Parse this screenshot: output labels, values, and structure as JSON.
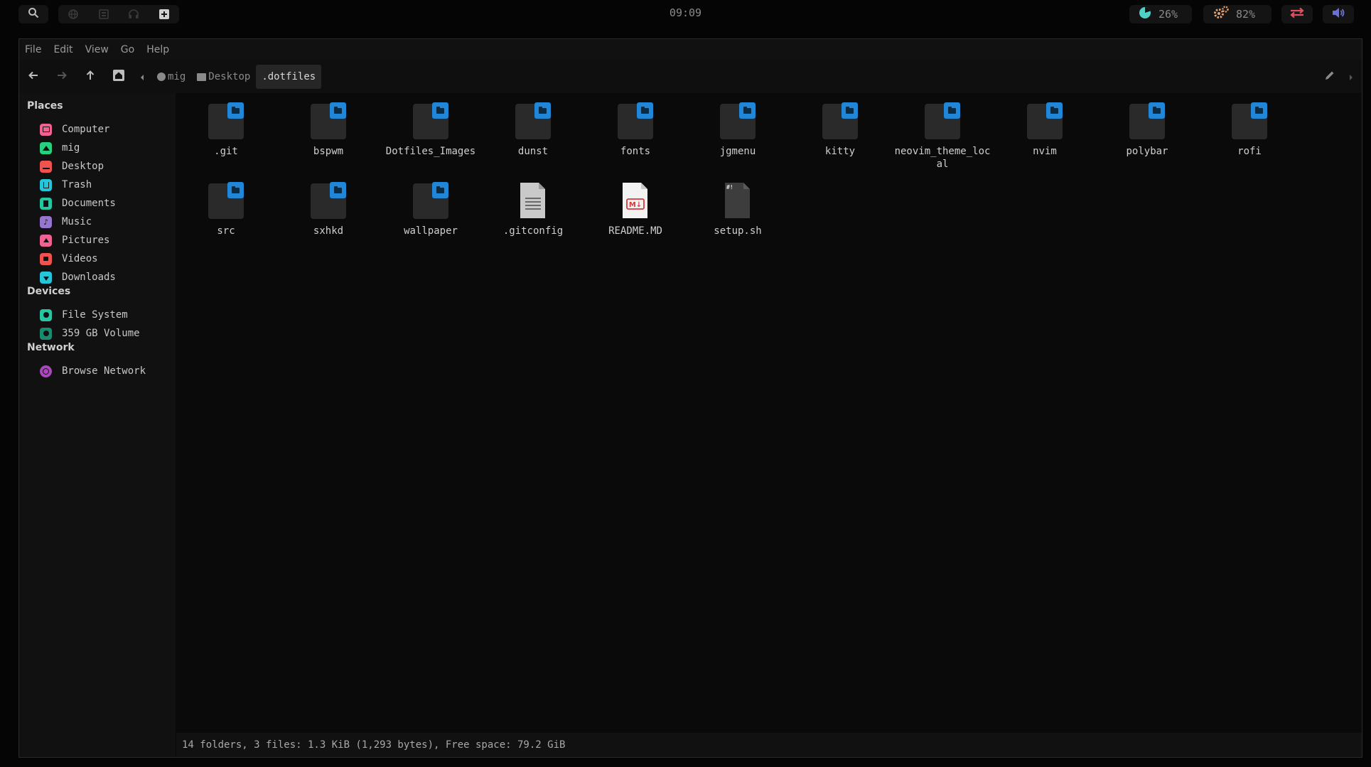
{
  "topbar": {
    "clock": "09:09",
    "cpu_value": "26%",
    "mem_value": "82%",
    "icons": [
      "search-icon",
      "globe-icon",
      "window-icon",
      "headphones-icon",
      "plus-icon",
      "pie-chart-icon",
      "gears-icon",
      "arrows-icon",
      "volume-icon"
    ],
    "accent_colors": {
      "cpu": "#4fd1c5",
      "mem": "#e0a070",
      "network": "#e05060",
      "volume": "#6b6fd8"
    }
  },
  "menu": [
    "File",
    "Edit",
    "View",
    "Go",
    "Help"
  ],
  "breadcrumbs": [
    {
      "label": "mig",
      "icon": "circle-icon",
      "active": false
    },
    {
      "label": "Desktop",
      "icon": "desktop-icon",
      "active": false
    },
    {
      "label": ".dotfiles",
      "icon": "",
      "active": true
    }
  ],
  "sidebar": {
    "places_title": "Places",
    "places": [
      {
        "label": "Computer",
        "color": "#f06292"
      },
      {
        "label": "mig",
        "color": "#26d07c"
      },
      {
        "label": "Desktop",
        "color": "#ef5350"
      },
      {
        "label": "Trash",
        "color": "#26c6da"
      },
      {
        "label": "Documents",
        "color": "#26c6a0"
      },
      {
        "label": "Music",
        "color": "#9575cd"
      },
      {
        "label": "Pictures",
        "color": "#f06292"
      },
      {
        "label": "Videos",
        "color": "#ef5350"
      },
      {
        "label": "Downloads",
        "color": "#26c6da"
      }
    ],
    "devices_title": "Devices",
    "devices": [
      {
        "label": "File System",
        "color": "#26c6a0"
      },
      {
        "label": "359 GB Volume",
        "color": "#1a8a70"
      }
    ],
    "network_title": "Network",
    "network": [
      {
        "label": "Browse Network",
        "color": "#ab47bc"
      }
    ]
  },
  "files": [
    {
      "name": ".git",
      "type": "folder"
    },
    {
      "name": "bspwm",
      "type": "folder"
    },
    {
      "name": "Dotfiles_Images",
      "type": "folder"
    },
    {
      "name": "dunst",
      "type": "folder"
    },
    {
      "name": "fonts",
      "type": "folder"
    },
    {
      "name": "jgmenu",
      "type": "folder"
    },
    {
      "name": "kitty",
      "type": "folder"
    },
    {
      "name": "neovim_theme_local",
      "type": "folder"
    },
    {
      "name": "nvim",
      "type": "folder"
    },
    {
      "name": "polybar",
      "type": "folder"
    },
    {
      "name": "rofi",
      "type": "folder"
    },
    {
      "name": "src",
      "type": "folder"
    },
    {
      "name": "sxhkd",
      "type": "folder"
    },
    {
      "name": "wallpaper",
      "type": "folder"
    },
    {
      "name": ".gitconfig",
      "type": "text"
    },
    {
      "name": "README.MD",
      "type": "markdown"
    },
    {
      "name": "setup.sh",
      "type": "script"
    }
  ],
  "markdown_badge": "M↓",
  "script_badge": "#!",
  "status": "14 folders, 3 files: 1.3 KiB (1,293 bytes), Free space: 79.2 GiB"
}
